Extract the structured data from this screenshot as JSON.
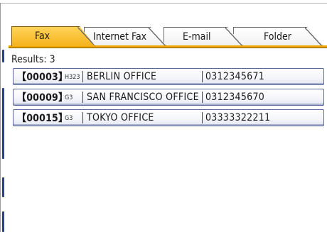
{
  "tabs": [
    {
      "label": "Fax",
      "active": true
    },
    {
      "label": "Internet Fax",
      "active": false
    },
    {
      "label": "E-mail",
      "active": false
    },
    {
      "label": "Folder",
      "active": false
    }
  ],
  "results_label": "Results: 3",
  "entries": [
    {
      "number": "【00003】",
      "category": "H323",
      "name": "BERLIN OFFICE",
      "fax": "0312345671"
    },
    {
      "number": "【00009】",
      "category": "G3",
      "name": "SAN FRANCISCO OFFICE",
      "fax": "0312345670"
    },
    {
      "number": "【00015】",
      "category": "G3",
      "name": "TOKYO OFFICE",
      "fax": "03333322211"
    }
  ],
  "colors": {
    "active_tab": "#f6b21b",
    "row_border": "#5a6a9a",
    "side_marks": "#2b3f8a"
  }
}
